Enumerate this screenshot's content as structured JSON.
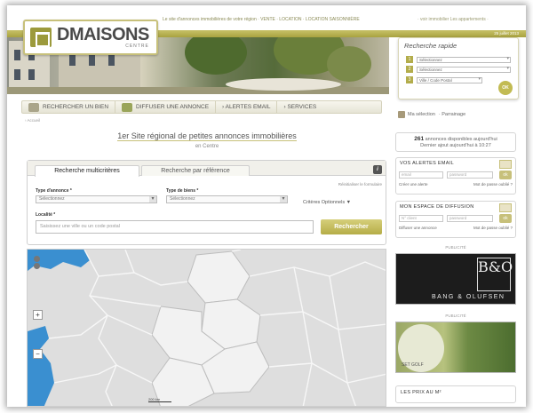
{
  "header": {
    "logo_text": "DMAISONS",
    "logo_sub": "CENTRE",
    "tagline": "Le site d'annonces immobilières de votre région · VENTE · LOCATION · LOCATION SAISONNIÈRE",
    "tagline_right": "· voir immobilier Les appartements ·",
    "date": "25 juillet 2013"
  },
  "rapid_search": {
    "title": "Recherche rapide",
    "fields": [
      {
        "num": "1",
        "value": "Sélectionnez"
      },
      {
        "num": "2",
        "value": "Sélectionnez"
      },
      {
        "num": "3",
        "value": "Ville / Code Postal"
      }
    ],
    "go_label": "OK"
  },
  "nav": {
    "items": [
      "RECHERCHER UN BIEN",
      "DIFFUSER UNE ANNONCE",
      "› ALERTES EMAIL",
      "› SERVICES"
    ],
    "selection_label": "Ma sélection",
    "selection_link": "· Parrainage"
  },
  "breadcrumb": "› Accueil",
  "slogan": {
    "part1": "1er Site régional de petites annonces immobilières",
    "line2": "en Centre"
  },
  "search": {
    "tab_multi": "Recherche multicritères",
    "tab_ref": "Recherche par référence",
    "info_icon": "i",
    "reinit": "Réinitialiser le formulaire",
    "type_annonce_label": "Type d'annonce *",
    "type_annonce_value": "Sélectionnez",
    "type_bien_label": "Type de biens *",
    "type_bien_value": "Sélectionnez",
    "criteres": "Critères Optionnels ▼",
    "localite_label": "Localité *",
    "localite_placeholder": "Saisissez une ville ou un code postal",
    "submit": "Rechercher"
  },
  "map": {
    "zoom_in": "+",
    "zoom_out": "−",
    "scale": "200 km"
  },
  "sidebar": {
    "count_number": "261",
    "count_text": "annonces disponibles aujourd'hui",
    "count_sub": "Dernier ajout aujourd'hui à 10:27",
    "alertes_title": "VOS ALERTES EMAIL",
    "alertes_email": "email",
    "alertes_pass": "password",
    "alertes_ok": "ok",
    "alertes_link1": "Créer une alerte",
    "alertes_link2": "Mot de passe oublié ?",
    "espace_title": "MON ESPACE DE DIFFUSION",
    "espace_id": "N° client",
    "espace_pass": "password",
    "espace_ok": "ok",
    "espace_link1": "Diffuser une annonce",
    "espace_link2": "Mot de passe oublié ?",
    "pub_label": "PUBLICITÉ",
    "ad1_logo": "B&O",
    "ad1_text": "BANG & OLUFSEN",
    "pub_label2": "PUBLICITÉ",
    "ad2_text": "SET GOLF",
    "prix_title": "LES PRIX AU M²"
  }
}
